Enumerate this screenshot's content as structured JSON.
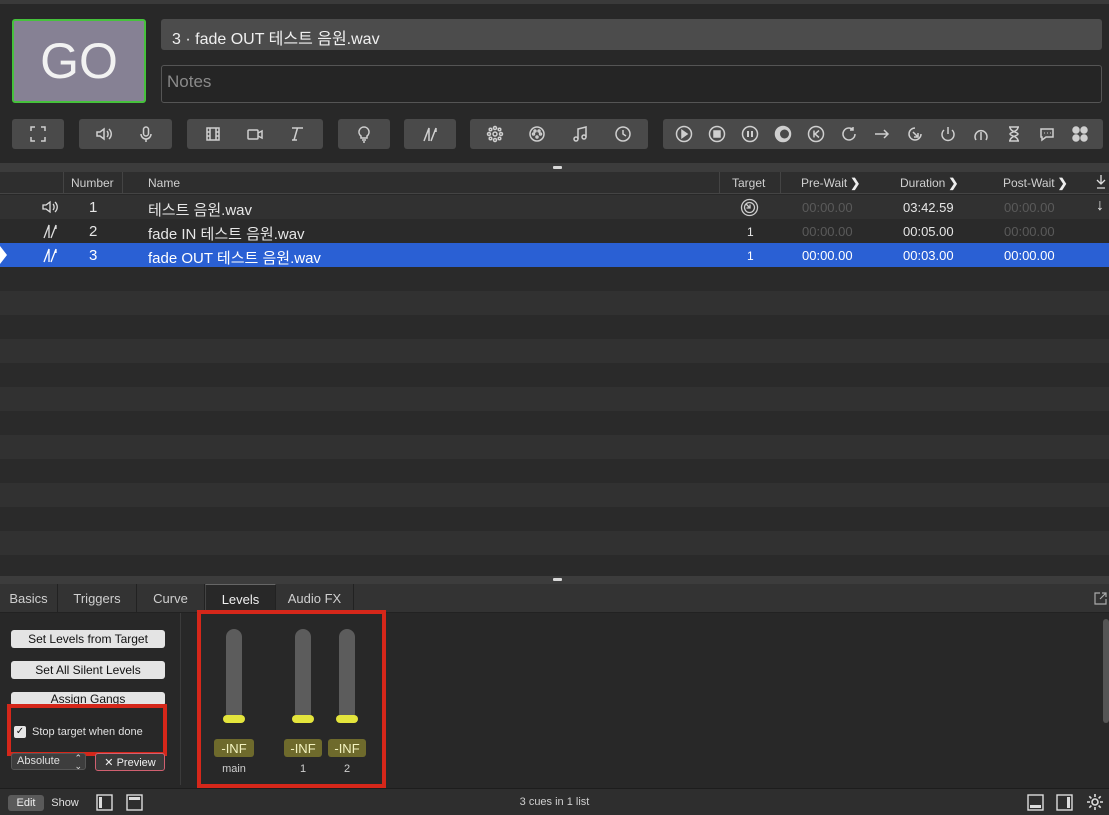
{
  "header": {
    "go_label": "GO",
    "cue_title": "3 · fade OUT 테스트 음원.wav",
    "notes_placeholder": "Notes"
  },
  "toolbar": {
    "icons": [
      "fullscreen-icon",
      "audio-icon",
      "mic-icon",
      "video-film-icon",
      "camera-icon",
      "text-icon",
      "light-bulb-icon",
      "fade-icon",
      "network-icon",
      "midi-icon",
      "music-note-icon",
      "clock-icon",
      "start-icon",
      "stop-icon",
      "pause-icon",
      "load-icon",
      "reset-icon",
      "devamp-icon",
      "goto-icon",
      "target-icon",
      "arm-icon",
      "disarm-icon",
      "wait-icon",
      "memo-icon",
      "group-icon"
    ]
  },
  "table": {
    "columns": {
      "number": "Number",
      "name": "Name",
      "target": "Target",
      "pre_wait": "Pre-Wait",
      "duration": "Duration",
      "post_wait": "Post-Wait"
    },
    "rows": [
      {
        "type_icon": "audio-icon",
        "number": "1",
        "name": "테스트 음원.wav",
        "target": "target-icon",
        "pre_wait": "00:00.00",
        "duration": "03:42.59",
        "post_wait": "00:00.00",
        "continue": "↓"
      },
      {
        "type_icon": "fade-icon",
        "number": "2",
        "name": "fade IN 테스트 음원.wav",
        "target": "1",
        "pre_wait": "00:00.00",
        "duration": "00:05.00",
        "post_wait": "00:00.00"
      },
      {
        "type_icon": "fade-icon",
        "number": "3",
        "name": "fade OUT 테스트 음원.wav",
        "target": "1",
        "pre_wait": "00:00.00",
        "duration": "00:03.00",
        "post_wait": "00:00.00",
        "selected": true
      }
    ]
  },
  "inspector": {
    "tabs": [
      "Basics",
      "Triggers",
      "Curve",
      "Levels",
      "Audio FX"
    ],
    "active_tab": "Levels",
    "buttons": {
      "set_from_target": "Set Levels from Target",
      "set_silent": "Set All Silent Levels",
      "assign_gangs": "Assign Gangs"
    },
    "stop_target": "Stop target when done",
    "stop_target_checked": true,
    "mode_select": "Absolute",
    "preview": "✕ Preview",
    "faders": [
      {
        "label": "main",
        "value": "-INF"
      },
      {
        "label": "1",
        "value": "-INF"
      },
      {
        "label": "2",
        "value": "-INF"
      }
    ]
  },
  "status": {
    "edit": "Edit",
    "show": "Show",
    "summary": "3 cues in 1 list"
  },
  "colors": {
    "go_border": "#46c13c",
    "selection": "#2a60d4",
    "highlight_box": "#d5271a",
    "fader_knob": "#e4e53c"
  }
}
